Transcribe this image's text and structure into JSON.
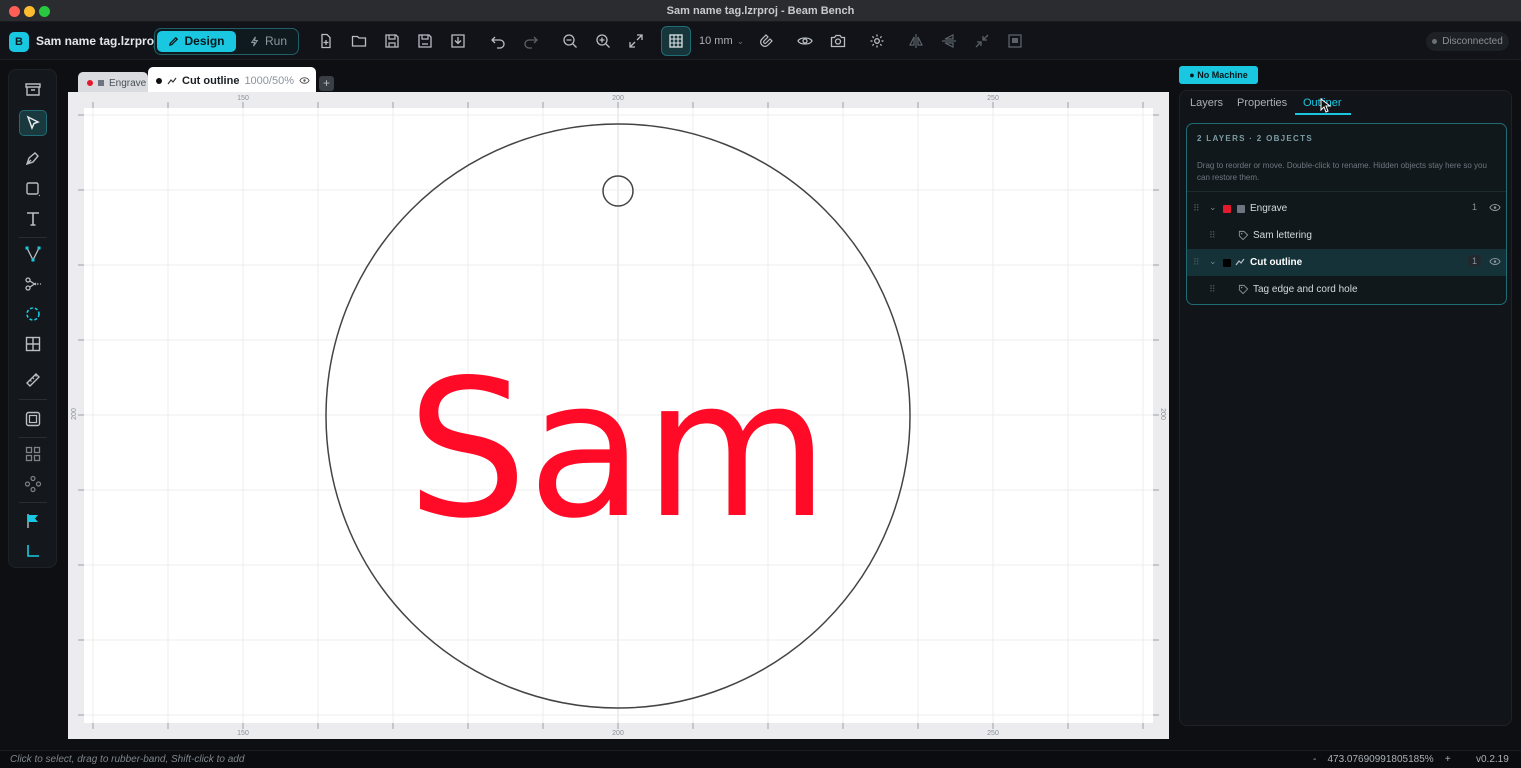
{
  "window": {
    "title": "Sam name tag.lzrproj - Beam Bench"
  },
  "toolbar": {
    "app_icon_letter": "B",
    "project_name": "Sam name tag.lzrproj",
    "mode_design": "Design",
    "mode_run": "Run",
    "grid_size": "10 mm",
    "connection_status": "Disconnected"
  },
  "tabs": [
    {
      "label": "Engrave",
      "color": "#e5192e"
    },
    {
      "label": "Cut outline",
      "sub": "1000/50%",
      "color": "#111111"
    }
  ],
  "ruler": {
    "x_ticks": [
      "150",
      "200",
      "250"
    ],
    "y_left": "200",
    "y_right": "200"
  },
  "canvas": {
    "text": "Sam",
    "text_color": "#ff0a27"
  },
  "panel": {
    "machine_label": "No Machine",
    "tabs": [
      "Layers",
      "Properties",
      "Outliner"
    ],
    "active_tab": "Outliner",
    "outliner_header": "2 LAYERS · 2 OBJECTS",
    "outliner_hint": "Drag to reorder or move. Double-click to rename. Hidden objects stay here so you can restore them.",
    "layers": [
      {
        "name": "Engrave",
        "count": "1",
        "color": "#e5192e",
        "object": "Sam lettering"
      },
      {
        "name": "Cut outline",
        "count": "1",
        "color": "#000000",
        "object": "Tag edge and cord hole"
      }
    ]
  },
  "statusbar": {
    "hint": "Click to select, drag to rubber-band, Shift-click to add",
    "zoom_minus": "-",
    "zoom": "473.076909918051​85%",
    "zoom_plus": "+",
    "version": "v0.2.19"
  },
  "colors": {
    "accent": "#19c8e0",
    "engrave": "#e5192e"
  }
}
